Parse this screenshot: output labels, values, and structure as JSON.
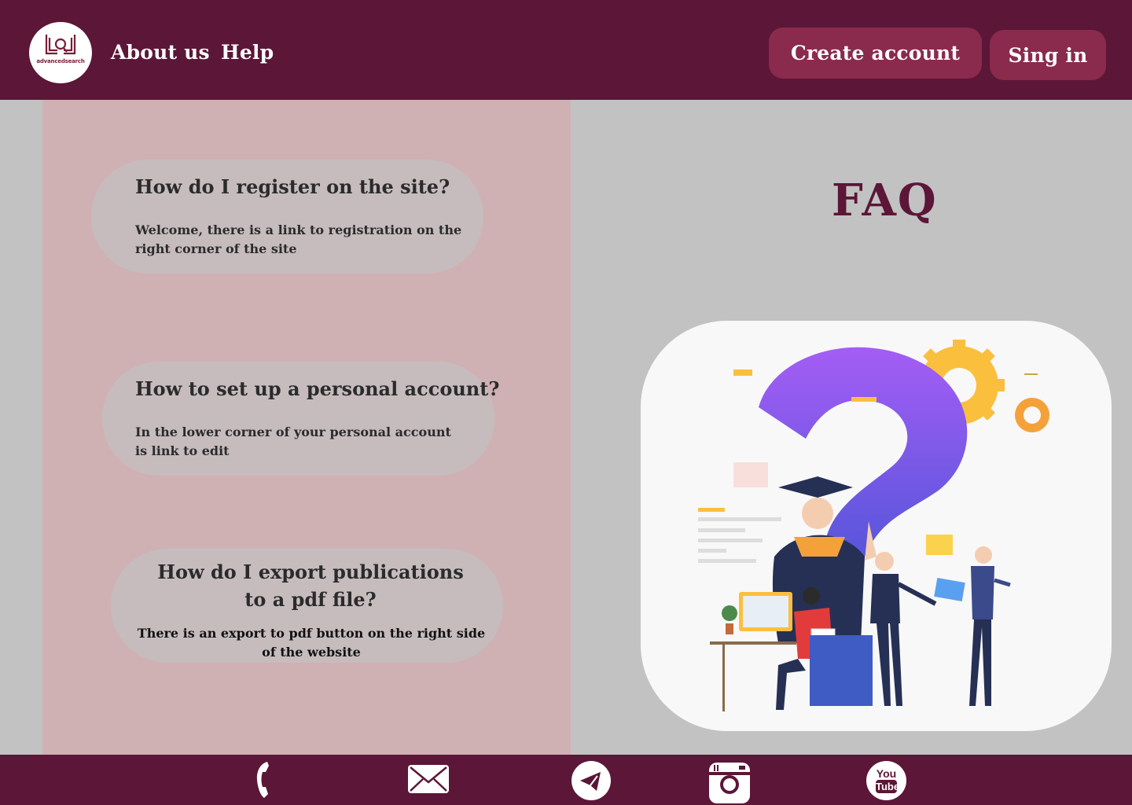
{
  "header": {
    "logo_text": "advancedsearch",
    "nav": {
      "about": "About us",
      "help": "Help"
    },
    "create_account_label": "Create account",
    "sign_in_label": "Sing in"
  },
  "faq": {
    "title": "FAQ",
    "items": [
      {
        "question": "How do I register on the site?",
        "answer": "Welcome, there is a link to registration on the right corner of the site"
      },
      {
        "question": "How to set up a personal account?",
        "answer": "In the lower corner of your personal account is link to edit"
      },
      {
        "question_line1": "How do I export publications",
        "question_line2": "to  a pdf file?",
        "answer": "There is an export to pdf button on the right side of the website"
      }
    ]
  },
  "illustration": {
    "icon": "question-mark-team-illustration"
  },
  "footer": {
    "icons": [
      "phone-icon",
      "mail-icon",
      "telegram-icon",
      "instagram-icon",
      "youtube-icon"
    ],
    "youtube_text_1": "You",
    "youtube_text_2": "Tube"
  },
  "colors": {
    "primary": "#5c1637",
    "button": "#8a2a4c",
    "panel": "#cfb1b3",
    "card": "#c6bcbe",
    "background": "#c2c2c2"
  }
}
